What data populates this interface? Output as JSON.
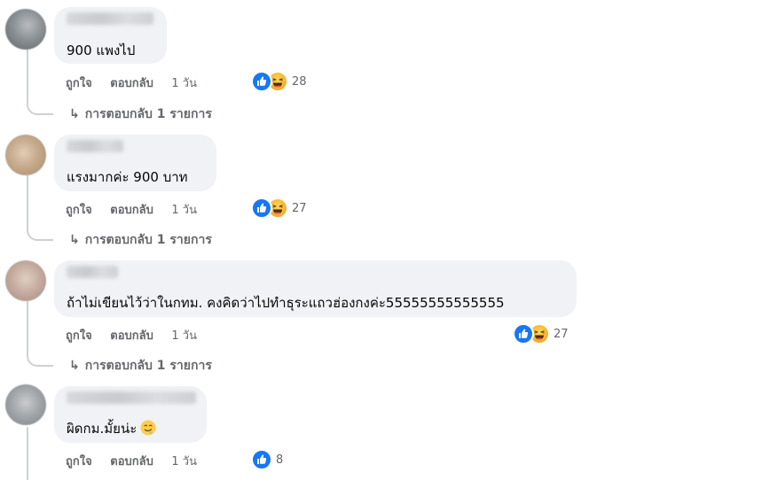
{
  "actions": {
    "like": "ถูกใจ",
    "reply": "ตอบกลับ"
  },
  "comments": [
    {
      "text": "900 แพงไป",
      "time": "1 วัน",
      "reaction_count": "28",
      "replies_link": "การตอบกลับ 1 รายการ"
    },
    {
      "text": "แรงมากค่ะ 900 บาท",
      "time": "1 วัน",
      "reaction_count": "27",
      "replies_link": "การตอบกลับ 1 รายการ"
    },
    {
      "text": "ถ้าไม่เขียนไว้ว่าในกทม. คงคิดว่าไปทำธุระแถวฮ่องกงค่ะ55555555555555",
      "time": "1 วัน",
      "reaction_count": "27",
      "replies_link": "การตอบกลับ 1 รายการ"
    },
    {
      "text": "ผิดกม.มั้ยน่ะ",
      "time": "1 วัน",
      "reaction_count": "8"
    }
  ],
  "icons": {
    "like": "like-reaction-icon",
    "haha": "haha-reaction-icon",
    "reply_arrow": "reply-arrow-icon",
    "emoji": "drooling-face-emoji"
  },
  "colors": {
    "bubble": "#f0f2f5",
    "meta_text": "#65676b",
    "like_blue": "#1877f2",
    "haha_yellow": "#f7b125"
  }
}
